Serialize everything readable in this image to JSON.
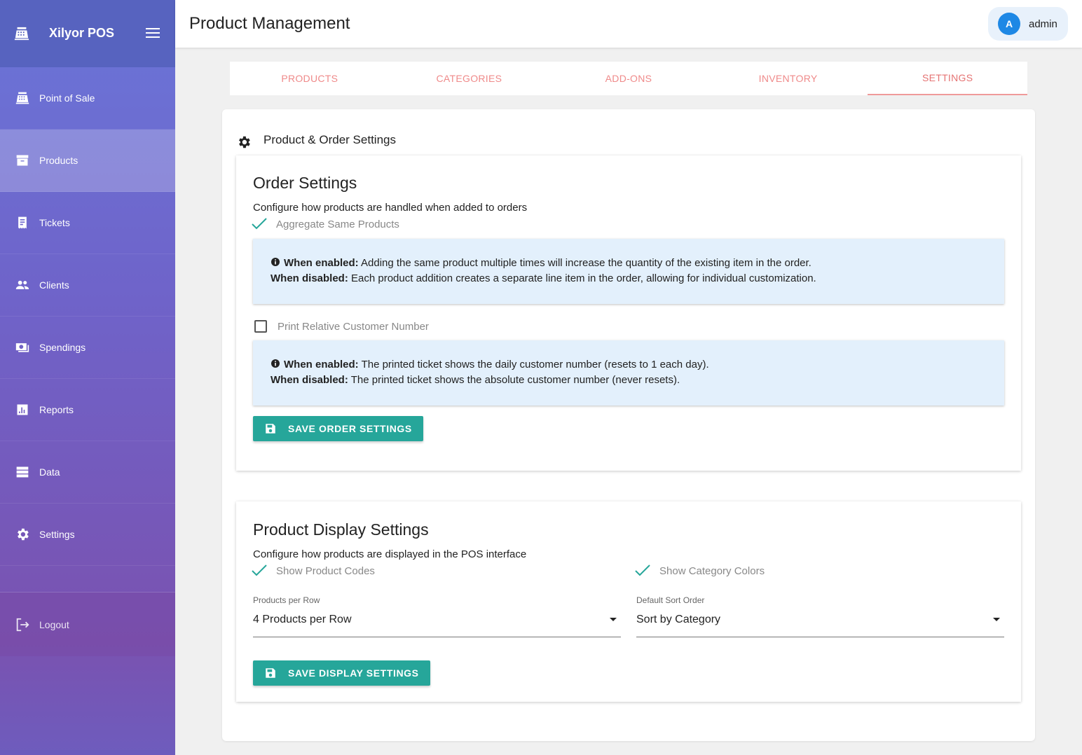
{
  "app": {
    "name": "Xilyor POS"
  },
  "sidebar": {
    "items": [
      {
        "label": "Point of Sale",
        "icon": "cash-register-icon"
      },
      {
        "label": "Products",
        "icon": "archive-box-icon"
      },
      {
        "label": "Tickets",
        "icon": "receipt-icon"
      },
      {
        "label": "Clients",
        "icon": "people-icon"
      },
      {
        "label": "Spendings",
        "icon": "money-icon"
      },
      {
        "label": "Reports",
        "icon": "bar-chart-icon"
      },
      {
        "label": "Data",
        "icon": "database-icon"
      },
      {
        "label": "Settings",
        "icon": "gear-icon"
      }
    ],
    "active": "Products",
    "logout_label": "Logout"
  },
  "header": {
    "title": "Product Management",
    "user": {
      "initial": "A",
      "name": "admin"
    }
  },
  "tabs": [
    {
      "label": "PRODUCTS"
    },
    {
      "label": "CATEGORIES"
    },
    {
      "label": "ADD-ONS"
    },
    {
      "label": "INVENTORY"
    },
    {
      "label": "SETTINGS"
    }
  ],
  "active_tab": "SETTINGS",
  "settings": {
    "section_title": "Product & Order Settings",
    "order": {
      "title": "Order Settings",
      "description": "Configure how products are handled when added to orders",
      "aggregate": {
        "label": "Aggregate Same Products",
        "checked": true
      },
      "aggregate_info": {
        "enabled_label": "When enabled:",
        "enabled_text": " Adding the same product multiple times will increase the quantity of the existing item in the order.",
        "disabled_label": "When disabled:",
        "disabled_text": " Each product addition creates a separate line item in the order, allowing for individual customization."
      },
      "relative_number": {
        "label": "Print Relative Customer Number",
        "checked": false
      },
      "relative_info": {
        "enabled_label": "When enabled:",
        "enabled_text": " The printed ticket shows the daily customer number (resets to 1 each day).",
        "disabled_label": "When disabled:",
        "disabled_text": " The printed ticket shows the absolute customer number (never resets)."
      },
      "save_label": "SAVE ORDER SETTINGS"
    },
    "display": {
      "title": "Product Display Settings",
      "description": "Configure how products are displayed in the POS interface",
      "show_codes": {
        "label": "Show Product Codes",
        "checked": true
      },
      "show_colors": {
        "label": "Show Category Colors",
        "checked": true
      },
      "per_row": {
        "label": "Products per Row",
        "value": "4 Products per Row"
      },
      "sort_order": {
        "label": "Default Sort Order",
        "value": "Sort by Category"
      },
      "save_label": "SAVE DISPLAY SETTINGS"
    }
  },
  "colors": {
    "accent": "#26a69a",
    "tab_text": "#ef8a8a",
    "info_bg": "#e3f0fc",
    "avatar": "#1e88e5"
  }
}
